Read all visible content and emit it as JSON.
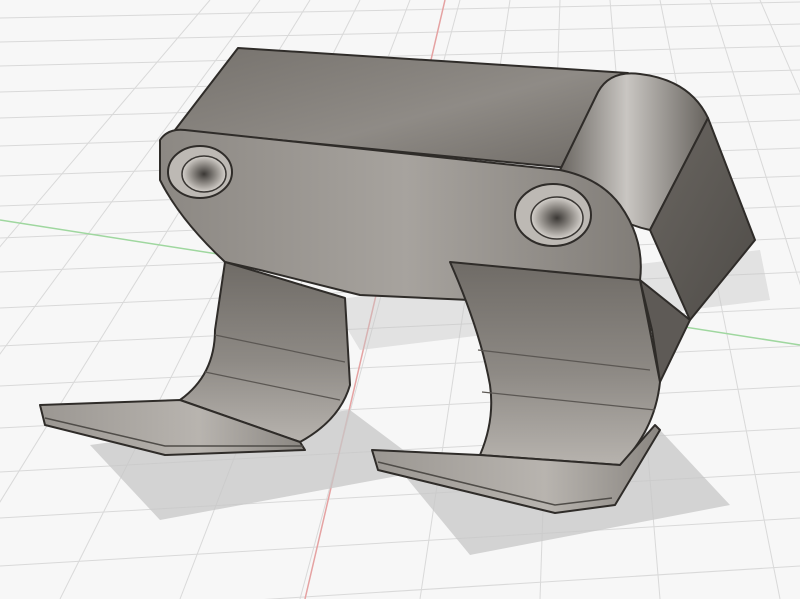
{
  "app": {
    "view": "3d-model-viewport",
    "background": "#f7f7f7"
  },
  "grid": {
    "visible": true,
    "minor_color": "#d6d6d6",
    "x_axis_color": "#e7a3a3",
    "y_axis_color": "#9fd79f"
  },
  "model": {
    "name": "",
    "type": "bracket-with-two-hooks",
    "material_color": "#8a8681",
    "edge_color": "#2f2c29",
    "shadow_color": "#c9c9c9"
  }
}
